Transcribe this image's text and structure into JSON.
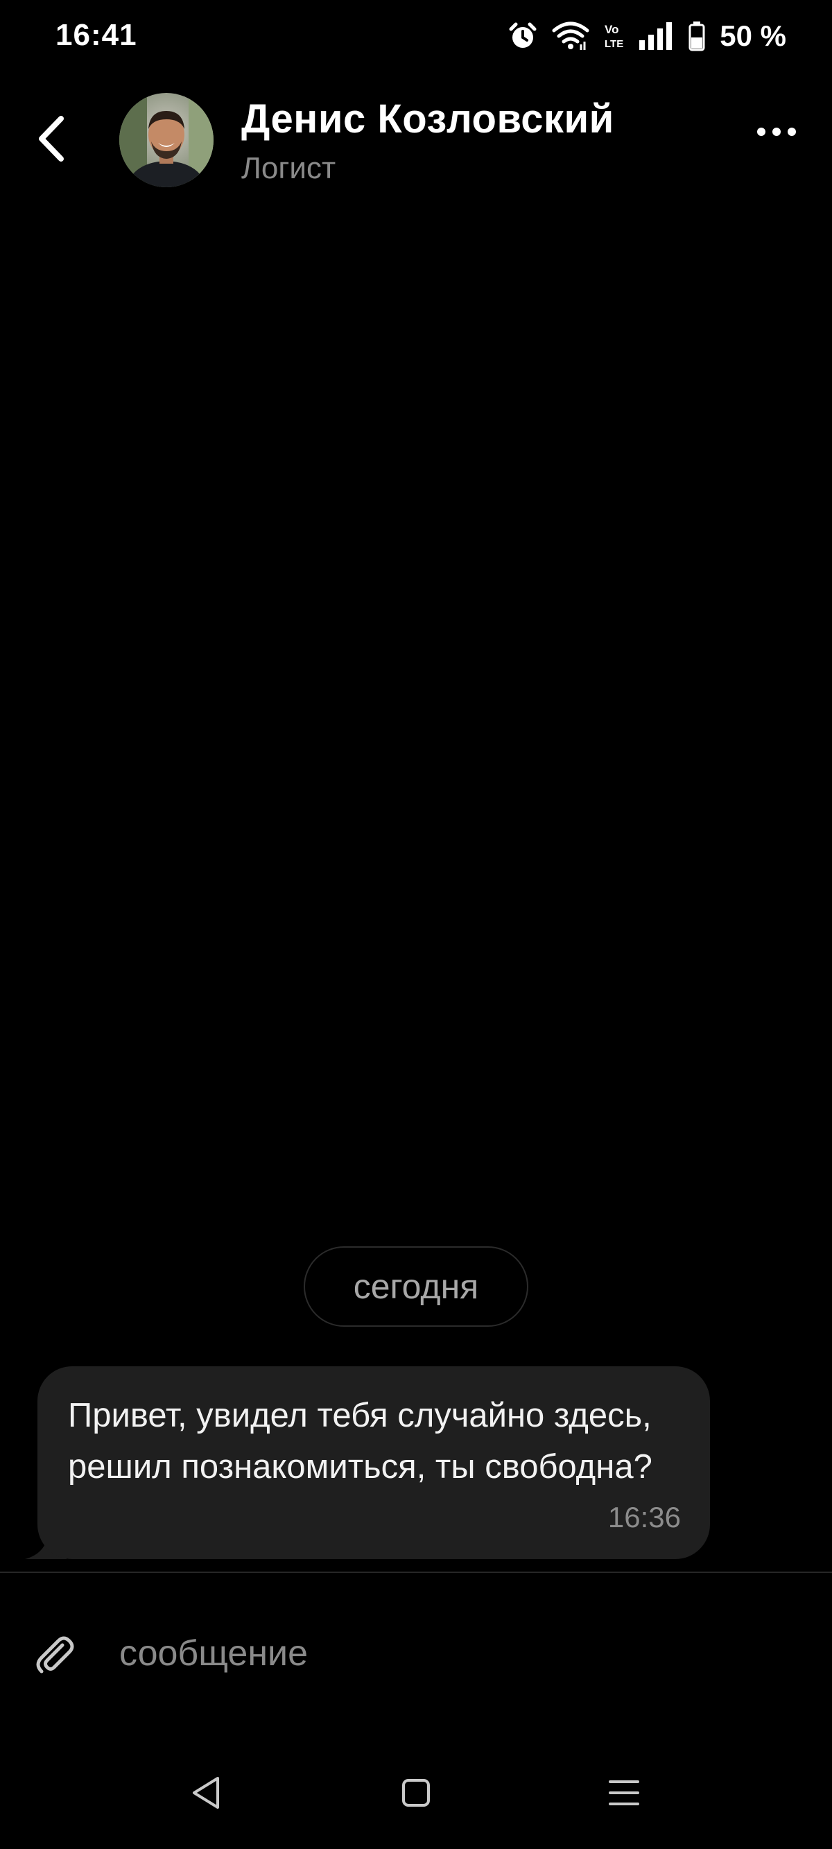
{
  "status_bar": {
    "time": "16:41",
    "battery_percent": "50 %",
    "icons": [
      "alarm-icon",
      "wifi-icon",
      "volte-icon",
      "signal-icon",
      "battery-icon"
    ]
  },
  "header": {
    "contact_name": "Денис Козловский",
    "contact_status": "Логист",
    "icons": [
      "back-arrow-icon",
      "avatar",
      "more-dots-icon"
    ]
  },
  "chat": {
    "date_separator": "сегодня",
    "messages": [
      {
        "text": "Привет, увидел тебя случайно здесь, решил познакомиться, ты свободна?",
        "time": "16:36",
        "direction": "incoming"
      }
    ]
  },
  "composer": {
    "placeholder": "сообщение",
    "value": "",
    "icons": [
      "paperclip-icon"
    ]
  },
  "nav_bar": {
    "icons": [
      "nav-back-icon",
      "nav-home-icon",
      "nav-recents-icon"
    ]
  },
  "colors": {
    "background": "#000000",
    "bubble": "#1f1f1f",
    "secondary_text": "#8a8a8a"
  }
}
